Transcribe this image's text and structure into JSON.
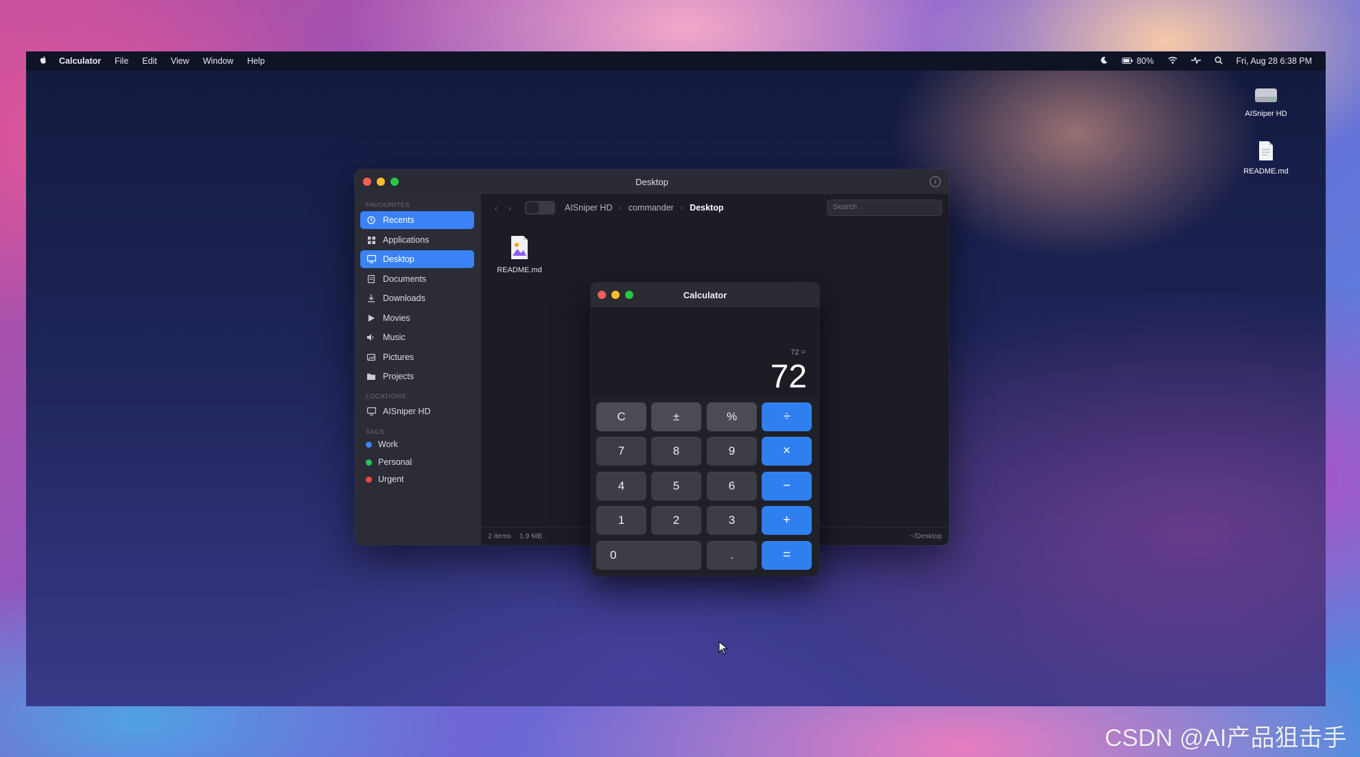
{
  "menubar": {
    "app_name": "Calculator",
    "menus": [
      "File",
      "Edit",
      "View",
      "Window",
      "Help"
    ],
    "battery": "80%",
    "datetime": "Fri, Aug 28 6:38 PM"
  },
  "desktop_icons": [
    {
      "label": "AISniper HD",
      "icon": "hard-drive-icon"
    },
    {
      "label": "README.md",
      "icon": "document-icon"
    }
  ],
  "finder": {
    "title": "Desktop",
    "sidebar": {
      "favourites_heading": "FAVOURITES",
      "items": [
        {
          "label": "Recents",
          "icon": "clock-icon",
          "selected": true
        },
        {
          "label": "Applications",
          "icon": "grid-icon",
          "selected": false
        },
        {
          "label": "Desktop",
          "icon": "monitor-icon",
          "selected": true
        },
        {
          "label": "Documents",
          "icon": "document-icon",
          "selected": false
        },
        {
          "label": "Downloads",
          "icon": "download-icon",
          "selected": false
        },
        {
          "label": "Movies",
          "icon": "play-icon",
          "selected": false
        },
        {
          "label": "Music",
          "icon": "speaker-icon",
          "selected": false
        },
        {
          "label": "Pictures",
          "icon": "image-icon",
          "selected": false
        },
        {
          "label": "Projects",
          "icon": "folder-icon",
          "selected": false
        }
      ],
      "locations_heading": "LOCATIONS",
      "locations": [
        {
          "label": "AISniper HD",
          "icon": "monitor-icon"
        }
      ],
      "tags_heading": "TAGS",
      "tags": [
        {
          "label": "Work",
          "color": "#3b82f6"
        },
        {
          "label": "Personal",
          "color": "#22c55e"
        },
        {
          "label": "Urgent",
          "color": "#ef4444"
        }
      ]
    },
    "breadcrumb": [
      "AISniper HD",
      "commander",
      "Desktop"
    ],
    "search_placeholder": "Search",
    "files": [
      {
        "label": "README.md",
        "icon": "image-file-icon"
      }
    ],
    "status": {
      "items": "2 items",
      "size": "1.9 MB",
      "path": "~/Desktop"
    }
  },
  "calculator": {
    "title": "Calculator",
    "expression": "72 =",
    "value": "72",
    "keys": {
      "clear": "C",
      "sign": "±",
      "percent": "%",
      "divide": "÷",
      "seven": "7",
      "eight": "8",
      "nine": "9",
      "multiply": "×",
      "four": "4",
      "five": "5",
      "six": "6",
      "minus": "−",
      "one": "1",
      "two": "2",
      "three": "3",
      "plus": "+",
      "zero": "0",
      "decimal": ".",
      "equals": "="
    },
    "operator_color": "#2f7ff0"
  },
  "dock": {
    "apps": [
      "finder-icon",
      "calculator-icon",
      "settings-icon",
      "terminal-icon",
      "launchpad-rocket-icon",
      "app-grid-icon",
      "trash-icon"
    ]
  },
  "watermark": "CSDN @AI产品狙击手"
}
